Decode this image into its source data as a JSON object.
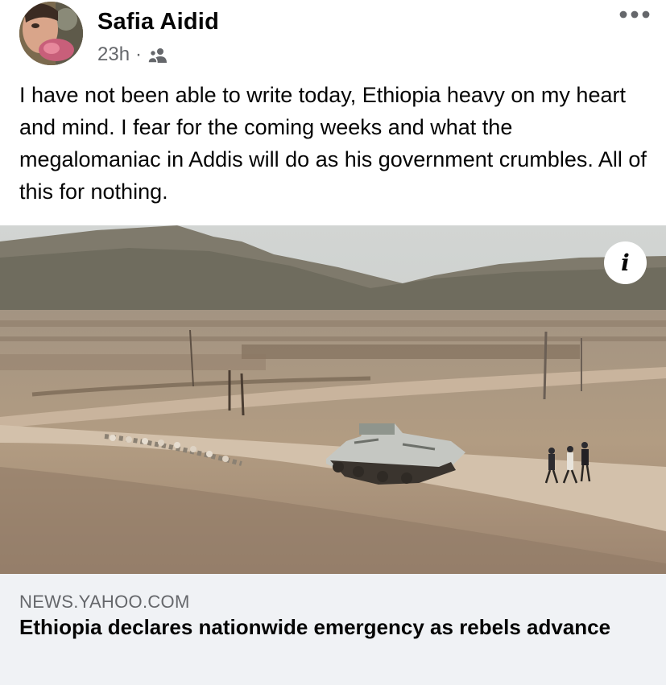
{
  "post": {
    "author": "Safia Aidid",
    "time": "23h",
    "separator": "·",
    "audience_icon": "friends-icon",
    "more_icon": "more-dots-icon",
    "text": "I have not been able to write today, Ethiopia heavy on my heart and mind. I fear for the coming weeks and what the megalomaniac in Addis will do as his government crumbles. All of this for nothing."
  },
  "link": {
    "info_icon": "info-icon",
    "info_glyph": "i",
    "domain": "NEWS.YAHOO.COM",
    "title": "Ethiopia declares nationwide emergency as rebels advance"
  },
  "colors": {
    "primary_text": "#050505",
    "secondary_text": "#65676b",
    "card_footer_bg": "#f0f2f5"
  }
}
